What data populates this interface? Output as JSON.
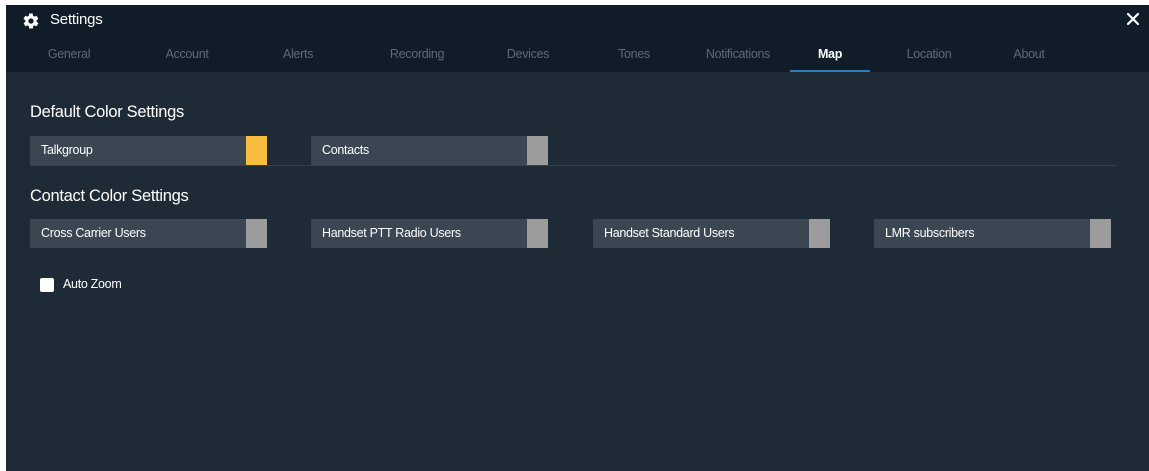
{
  "window": {
    "title": "Settings",
    "icon": "gear-icon",
    "close_icon": "close-icon"
  },
  "tabs": [
    {
      "label": "General",
      "active": false
    },
    {
      "label": "Account",
      "active": false
    },
    {
      "label": "Alerts",
      "active": false
    },
    {
      "label": "Recording",
      "active": false
    },
    {
      "label": "Devices",
      "active": false
    },
    {
      "label": "Tones",
      "active": false
    },
    {
      "label": "Notifications",
      "active": false
    },
    {
      "label": "Map",
      "active": true
    },
    {
      "label": "Location",
      "active": false
    },
    {
      "label": "About",
      "active": false
    }
  ],
  "default_colors": {
    "heading": "Default Color Settings",
    "items": [
      {
        "label": "Talkgroup",
        "color": "#f6bd3f"
      },
      {
        "label": "Contacts",
        "color": "#9c9c9c"
      }
    ]
  },
  "contact_colors": {
    "heading": "Contact Color Settings",
    "items": [
      {
        "label": "Cross Carrier Users",
        "color": "#9c9c9c"
      },
      {
        "label": "Handset PTT Radio Users",
        "color": "#9c9c9c"
      },
      {
        "label": "Handset Standard Users",
        "color": "#9c9c9c"
      },
      {
        "label": "LMR subscribers",
        "color": "#9c9c9c"
      }
    ]
  },
  "auto_zoom": {
    "label": "Auto Zoom",
    "checked": false
  },
  "colors": {
    "background": "#1e2a36",
    "titlebar": "#101c27",
    "tab_inactive": "#5d6a76",
    "tab_active_underline": "#2e7fb9",
    "row": "#3a4651"
  }
}
